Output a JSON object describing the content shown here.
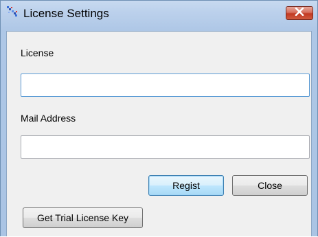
{
  "window": {
    "title": "License Settings",
    "icon": "app-settings-icon",
    "close_icon": "close-icon"
  },
  "form": {
    "license_label": "License",
    "license_value": "",
    "mail_label": "Mail Address",
    "mail_value": ""
  },
  "buttons": {
    "regist": "Regist",
    "close": "Close",
    "trial": "Get Trial License Key"
  },
  "colors": {
    "title_gradient": "#bcd1ec",
    "close_button": "#c23a22",
    "focus_border": "#5b9bd5"
  }
}
